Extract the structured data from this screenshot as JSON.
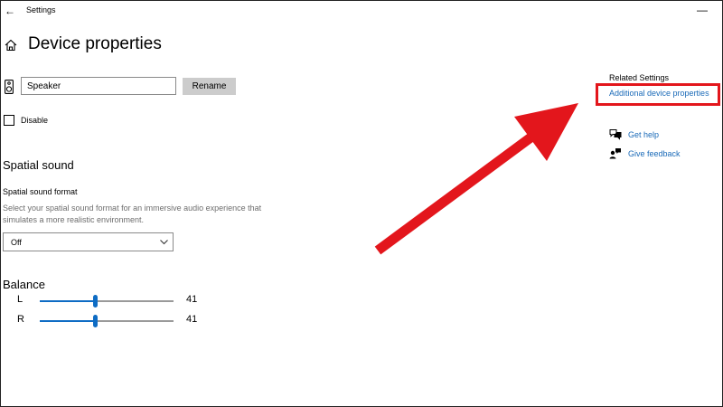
{
  "window": {
    "title": "Settings",
    "back_glyph": "←",
    "minimize_glyph": "—"
  },
  "page": {
    "title": "Device properties"
  },
  "device": {
    "name_value": "Speaker",
    "rename_label": "Rename",
    "disable_label": "Disable",
    "disable_checked": false
  },
  "spatial_sound": {
    "heading": "Spatial sound",
    "format_label": "Spatial sound format",
    "description": "Select your spatial sound format for an immersive audio experience that simulates a more realistic environment.",
    "selected_value": "Off"
  },
  "balance": {
    "heading": "Balance",
    "left": {
      "label": "L",
      "value": "41"
    },
    "right": {
      "label": "R",
      "value": "41"
    }
  },
  "related": {
    "heading": "Related Settings",
    "additional_link": "Additional device properties",
    "help_label": "Get help",
    "feedback_label": "Give feedback"
  },
  "icons": {
    "home": "home-icon",
    "speaker": "speaker-icon",
    "chevron": "chevron-down-icon",
    "help": "help-chat-icon",
    "feedback": "feedback-person-icon"
  },
  "colors": {
    "accent": "#0e6cc4",
    "link": "#1a6ab8",
    "annotation": "#e3161c"
  }
}
